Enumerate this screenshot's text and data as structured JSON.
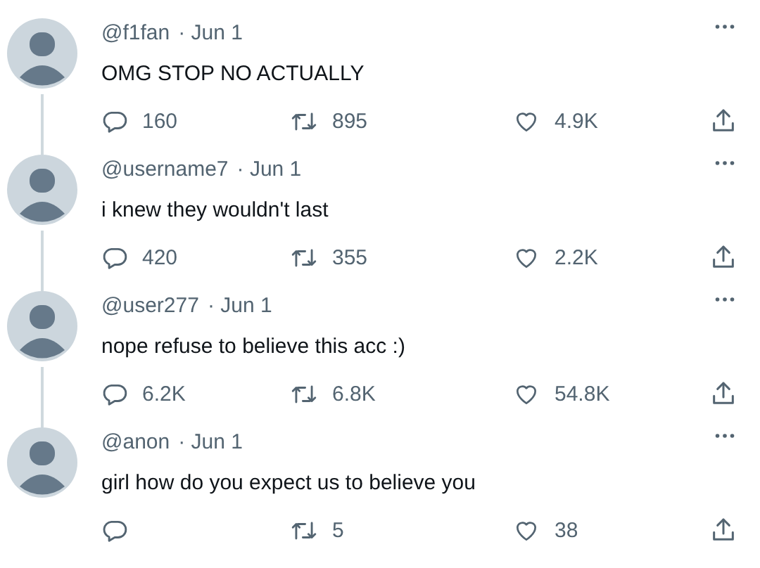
{
  "tweets": [
    {
      "handle": "@f1fan",
      "date": "· Jun 1",
      "text": "OMG STOP NO ACTUALLY",
      "replies": "160",
      "retweets": "895",
      "likes": "4.9K",
      "thread_below": true
    },
    {
      "handle": "@username7",
      "date": "· Jun 1",
      "text": "i knew they wouldn't last",
      "replies": "420",
      "retweets": "355",
      "likes": "2.2K",
      "thread_below": true
    },
    {
      "handle": "@user277",
      "date": "· Jun 1",
      "text": "nope refuse to believe this acc :)",
      "replies": "6.2K",
      "retweets": "6.8K",
      "likes": "54.8K",
      "thread_below": true
    },
    {
      "handle": "@anon",
      "date": "· Jun 1",
      "text": "girl how do you expect us to believe you",
      "retweets": "5",
      "likes": "38"
    }
  ]
}
